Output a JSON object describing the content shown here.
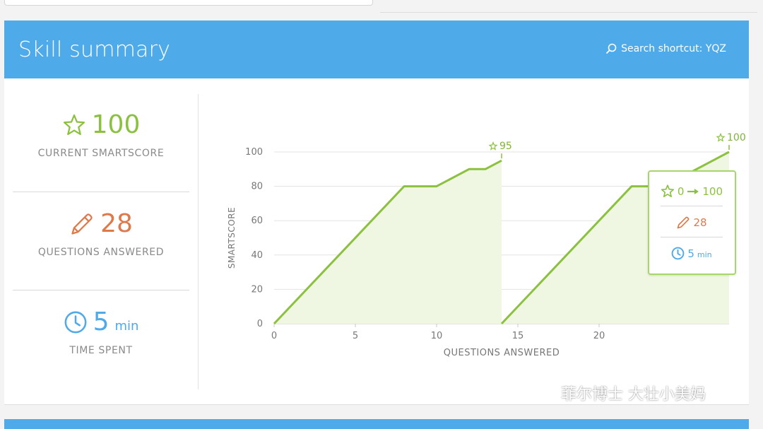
{
  "header": {
    "title": "Skill summary",
    "search_shortcut": "Search shortcut: YQZ"
  },
  "stats": {
    "smartscore": {
      "value": "100",
      "label": "CURRENT SMARTSCORE"
    },
    "questions": {
      "value": "28",
      "label": "QUESTIONS ANSWERED"
    },
    "time": {
      "value": "5",
      "unit": "min",
      "label": "TIME SPENT"
    }
  },
  "chart_data": {
    "type": "line",
    "title": "",
    "xlabel": "QUESTIONS ANSWERED",
    "ylabel": "SMARTSCORE",
    "xlim": [
      0,
      28
    ],
    "ylim": [
      0,
      100
    ],
    "xticks": [
      0,
      5,
      10,
      15,
      20
    ],
    "yticks": [
      0,
      20,
      40,
      60,
      80,
      100
    ],
    "grid": true,
    "series": [
      {
        "x": [
          0,
          8,
          10,
          12,
          13,
          14
        ],
        "y": [
          0,
          80,
          80,
          90,
          90,
          95
        ],
        "end_label": "95"
      },
      {
        "x": [
          14,
          22,
          24,
          28
        ],
        "y": [
          0,
          80,
          80,
          100
        ],
        "end_label": "100"
      }
    ],
    "colors": {
      "line": "#8cc13f",
      "fill": "#eff7e2"
    }
  },
  "tooltip": {
    "score_from": "0",
    "score_to": "100",
    "questions": "28",
    "time": "5",
    "time_unit": "min"
  },
  "icons": {
    "smartscore": "star-icon",
    "questions": "pencil-icon",
    "time": "clock-icon",
    "search": "search-icon",
    "watermark": "wechat-icon"
  },
  "colors": {
    "header": "#4eaae8",
    "green": "#8cc13f",
    "orange": "#e0794a",
    "blue": "#4eaae8"
  },
  "watermark": {
    "text": "菲尔博士 大壮小美妈"
  }
}
